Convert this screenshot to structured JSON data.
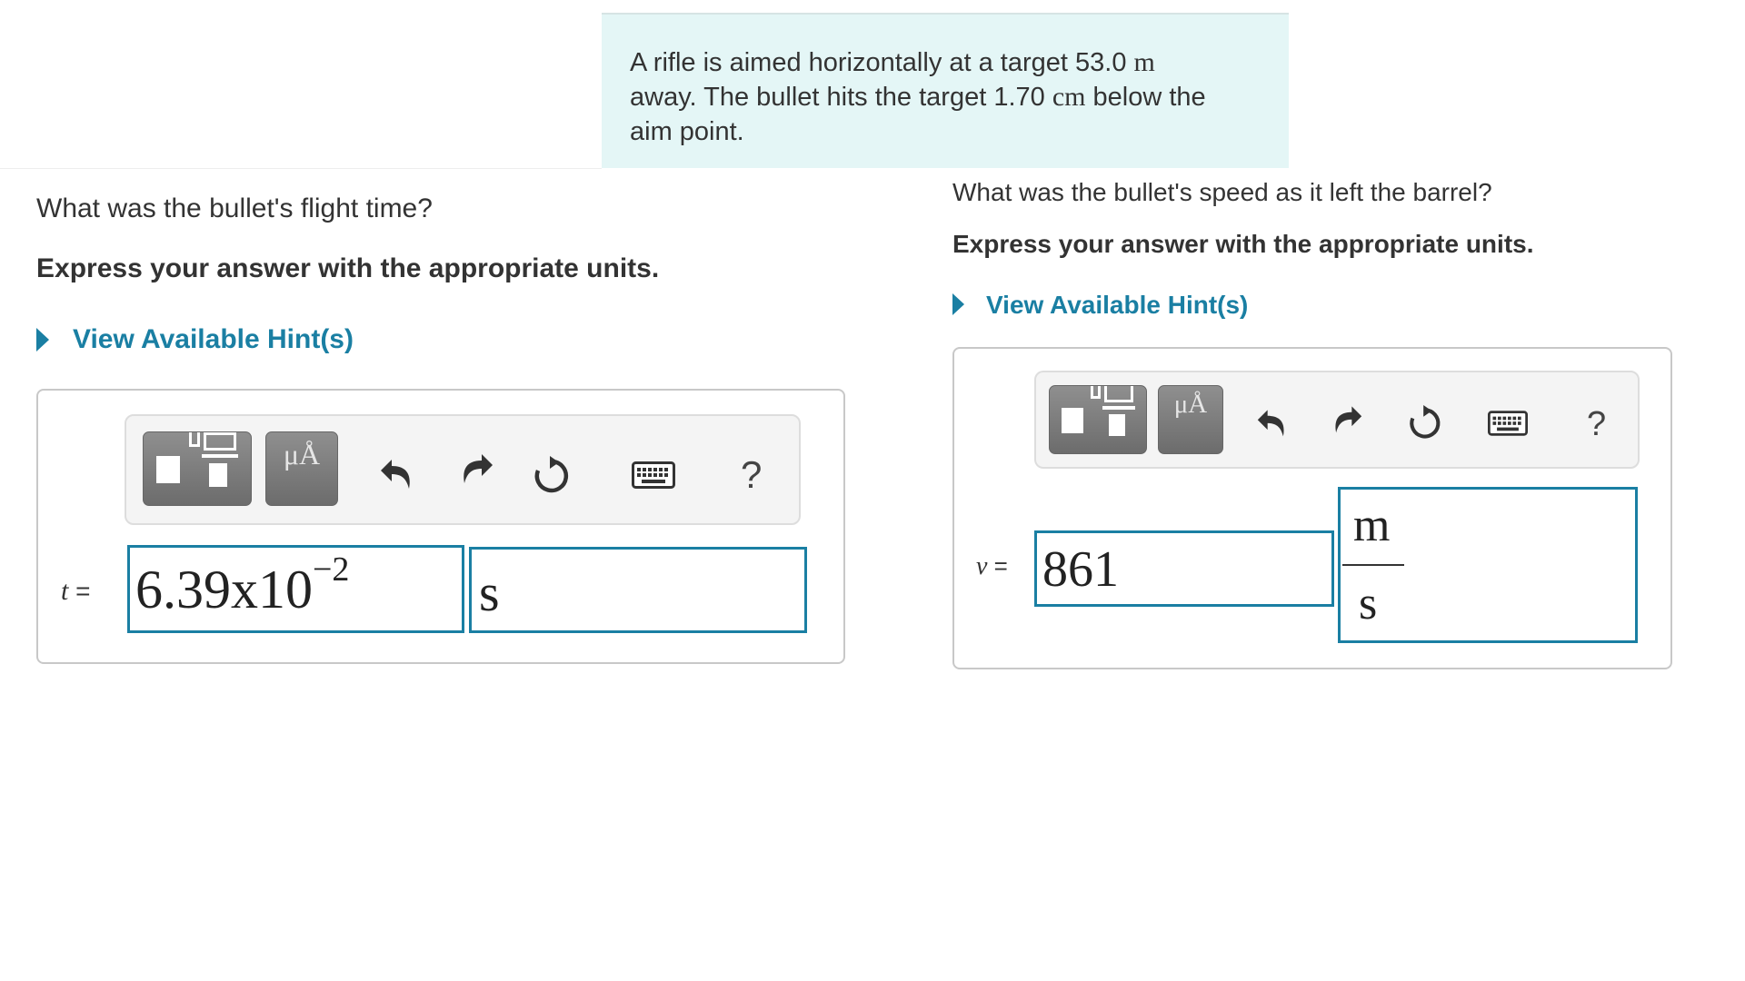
{
  "problem": {
    "text_1": "A rifle is aimed horizontally at a target 53.0 ",
    "unit_1": "m",
    "text_2": "away. The bullet hits the target 1.70 ",
    "unit_2": "cm",
    "text_3": " below the",
    "text_4": "aim point."
  },
  "part_a": {
    "question": "What was the bullet's flight time?",
    "instruction": "Express your answer with the appropriate units.",
    "hint_link": "View Available Hint(s)",
    "toolbar": {
      "template_icon": "fraction-template-icon",
      "units_label": "μÅ",
      "undo_icon": "undo-icon",
      "redo_icon": "redo-icon",
      "reset_icon": "reset-icon",
      "keyboard_icon": "keyboard-icon",
      "help_label": "?"
    },
    "variable": "t",
    "equals": "=",
    "value_mantissa": "6.39x10",
    "value_exponent": "−2",
    "unit": "s"
  },
  "part_b": {
    "question": "What was the bullet's speed as it left the barrel?",
    "instruction": "Express your answer with the appropriate units.",
    "hint_link": "View Available Hint(s)",
    "toolbar": {
      "template_icon": "fraction-template-icon",
      "units_label": "μÅ",
      "undo_icon": "undo-icon",
      "redo_icon": "redo-icon",
      "reset_icon": "reset-icon",
      "keyboard_icon": "keyboard-icon",
      "help_label": "?"
    },
    "variable": "v",
    "equals": "=",
    "value": "861",
    "unit_numerator": "m",
    "unit_denominator": "s"
  },
  "colors": {
    "link": "#1a7fa3",
    "problem_bg": "#e4f6f6",
    "field_border": "#1a7fa3",
    "button_gray": "#7a7a7a"
  }
}
